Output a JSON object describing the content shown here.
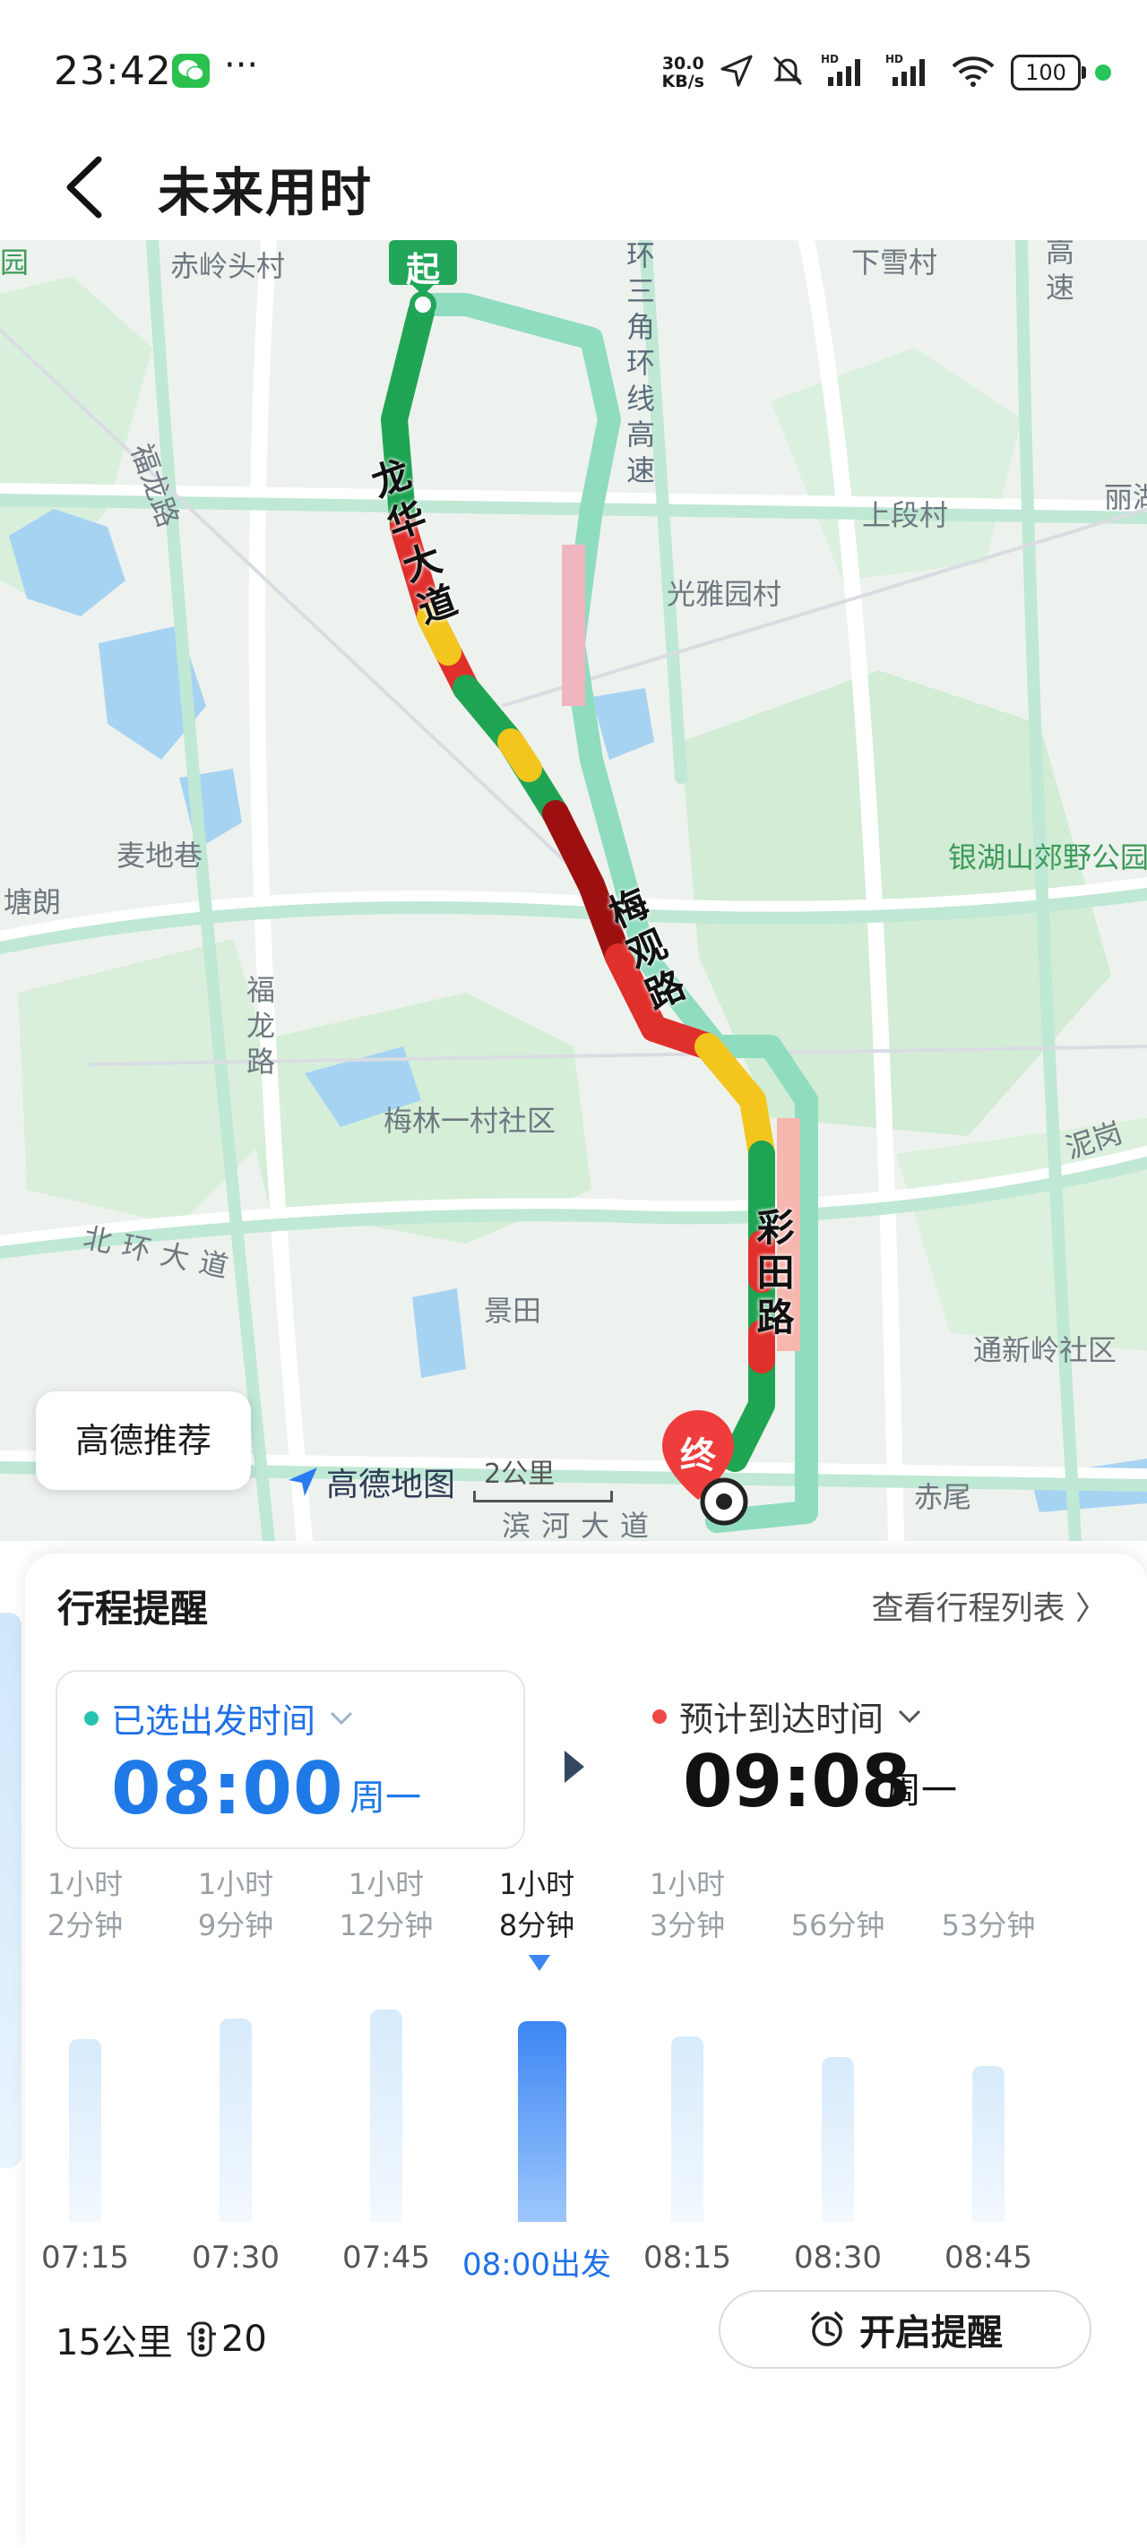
{
  "status_bar": {
    "time": "23:42",
    "net_speed_value": "30.0",
    "net_speed_unit": "KB/s",
    "battery": "100",
    "icons": [
      "wechat-icon",
      "more-icon",
      "location-icon",
      "mute-icon",
      "signal-hd-icon",
      "signal-hd-icon",
      "wifi-icon",
      "battery-icon",
      "dot-icon"
    ]
  },
  "header": {
    "title": "未来用时"
  },
  "map": {
    "labels": [
      "赤岭头村",
      "下雪村",
      "高速",
      "福龙路",
      "上段村",
      "丽湖",
      "光雅园村",
      "麦地巷",
      "塘朗",
      "银湖山郊野公园",
      "福龙路",
      "梅林一村社区",
      "泥岗",
      "北环大道",
      "景田",
      "通新岭社区",
      "赤尾",
      "滨河大道",
      "园"
    ],
    "route_roads": [
      "龙华大道",
      "梅观路",
      "彩田路",
      "环三角环线高速"
    ],
    "start_marker": "起",
    "end_marker": "终",
    "recommend_button": "高德推荐",
    "logo": "高德地图",
    "scale": "2公里"
  },
  "sheet": {
    "title": "行程提醒",
    "view_list": "查看行程列表",
    "departure": {
      "label": "已选出发时间",
      "time": "08:00",
      "weekday": "周一"
    },
    "arrival": {
      "label": "预计到达时间",
      "time": "09:08",
      "weekday": "周一"
    },
    "bars": [
      {
        "dur_line1": "1小时",
        "dur_line2": "2分钟",
        "time": "07:15",
        "minutes": 62
      },
      {
        "dur_line1": "1小时",
        "dur_line2": "9分钟",
        "time": "07:30",
        "minutes": 69
      },
      {
        "dur_line1": "1小时",
        "dur_line2": "12分钟",
        "time": "07:45",
        "minutes": 72
      },
      {
        "dur_line1": "1小时",
        "dur_line2": "8分钟",
        "time": "08:00出发",
        "minutes": 68,
        "selected": true
      },
      {
        "dur_line1": "1小时",
        "dur_line2": "3分钟",
        "time": "08:15",
        "minutes": 63
      },
      {
        "dur_line1": "",
        "dur_line2": "56分钟",
        "time": "08:30",
        "minutes": 56
      },
      {
        "dur_line1": "",
        "dur_line2": "53分钟",
        "time": "08:45",
        "minutes": 53
      }
    ],
    "distance": "15公里",
    "traffic_lights": "20",
    "reminder_button": "开启提醒"
  },
  "colors": {
    "accent": "#1f7ae8",
    "route_green": "#1fa453",
    "route_yellow": "#f2c61c",
    "route_red": "#e0302c",
    "route_darkred": "#9e1010",
    "alt_route": "#8fdcbf"
  }
}
